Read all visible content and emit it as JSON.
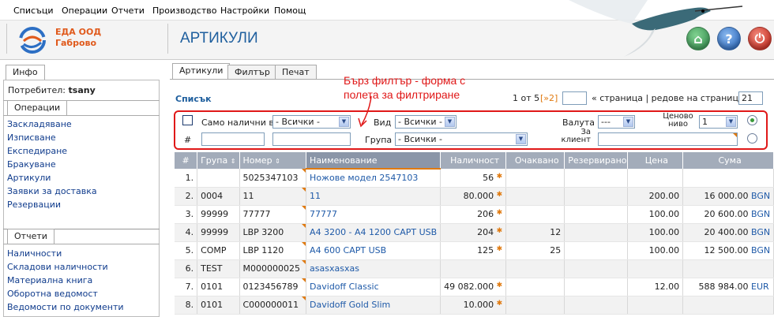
{
  "menu": [
    "Списъци",
    "Операции",
    "Отчети",
    "Производство",
    "Настройки",
    "Помощ"
  ],
  "company": {
    "line1": "ЕДА ООД",
    "line2": "Габрово"
  },
  "page_title": "АРТИКУЛИ",
  "header_buttons": [
    {
      "name": "home-icon",
      "color": "#3f9a5a",
      "glyph": "⌂"
    },
    {
      "name": "help-icon",
      "color": "#2d6fc4",
      "glyph": "?"
    },
    {
      "name": "power-icon",
      "color": "#d7281c",
      "glyph": "⏻"
    }
  ],
  "left": {
    "info_tab": "Инфо",
    "user_label": "Потребител:",
    "user_name": "tsany",
    "operations_tab": "Операции",
    "operations": [
      "Заскладяване",
      "Изписване",
      "Експедиране",
      "Бракуване",
      "Артикули",
      "Заявки за доставка",
      "Резервации"
    ],
    "reports_tab": "Отчети",
    "reports": [
      "Наличности",
      "Складови наличности",
      "Материална книга",
      "Оборотна ведомост",
      "Ведомости по документи"
    ]
  },
  "tabs": [
    "Артикули",
    "Филтър",
    "Печат"
  ],
  "list_title": "Списък",
  "annotation": "Бърз филтър - форма с полета за филтриране",
  "pager": {
    "range": "1 от 5",
    "next": "[»2]",
    "page_value": "",
    "middle": "« страница | редове на страница »",
    "rows": "21"
  },
  "filter": {
    "only_available_label": "Само налични в",
    "store_value": "- Всички -",
    "kind_label": "Вид",
    "kind_value": "- Всички -",
    "currency_label": "Валута",
    "currency_value": "---",
    "price_level_label": "Ценово ниво",
    "price_level_value": "1",
    "hash_label": "#",
    "group_label": "Група",
    "group_value": "- Всички -",
    "client_label": "За клиент"
  },
  "table": {
    "columns": [
      "#",
      "Група",
      "Номер",
      "Наименование",
      "Наличност",
      "Очаквано",
      "Резервирано",
      "Цена",
      "Сума"
    ],
    "rows": [
      {
        "n": "1.",
        "group": "",
        "num": "5025347103",
        "name": "Ножове модел 2547103",
        "qty": "56",
        "exp": "",
        "res": "",
        "price": "",
        "sum": "",
        "cur": ""
      },
      {
        "n": "2.",
        "group": "0004",
        "num": "11",
        "name": "11",
        "qty": "80.000",
        "exp": "",
        "res": "",
        "price": "200.00",
        "sum": "16 000.00",
        "cur": "BGN"
      },
      {
        "n": "3.",
        "group": "99999",
        "num": "77777",
        "name": "77777",
        "qty": "206",
        "exp": "",
        "res": "",
        "price": "100.00",
        "sum": "20 600.00",
        "cur": "BGN"
      },
      {
        "n": "4.",
        "group": "99999",
        "num": "LBP 3200",
        "name": "A4 3200 - A4 1200 CAPT USB",
        "qty": "204",
        "exp": "12",
        "res": "",
        "price": "100.00",
        "sum": "20 400.00",
        "cur": "BGN"
      },
      {
        "n": "5.",
        "group": "COMP",
        "num": "LBP 1120",
        "name": "A4 600 CAPT USB",
        "qty": "125",
        "exp": "25",
        "res": "",
        "price": "100.00",
        "sum": "12 500.00",
        "cur": "BGN"
      },
      {
        "n": "6.",
        "group": "TEST",
        "num": "M000000025",
        "name": "asasxasxas",
        "qty": "",
        "exp": "",
        "res": "",
        "price": "",
        "sum": "",
        "cur": ""
      },
      {
        "n": "7.",
        "group": "0101",
        "num": "0123456789",
        "name": "Davidoff Classic",
        "qty": "49 082.000",
        "exp": "",
        "res": "",
        "price": "12.00",
        "sum": "588 984.00",
        "cur": "EUR"
      },
      {
        "n": "8.",
        "group": "0101",
        "num": "C000000011",
        "name": "Davidoff Gold Slim",
        "qty": "10.000",
        "exp": "",
        "res": "",
        "price": "",
        "sum": "",
        "cur": ""
      }
    ]
  },
  "colors": {
    "accent": "#1f5f9e",
    "company": "#e05a1c",
    "annotation": "#e01818",
    "header_bg": "#a3acba"
  }
}
